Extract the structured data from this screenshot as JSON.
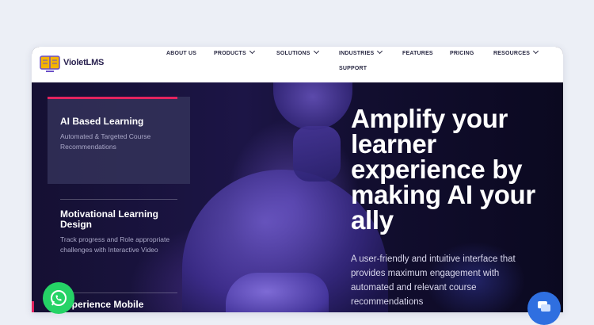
{
  "brand": {
    "name": "VioletLMS",
    "logo_icon": "book-icon"
  },
  "nav": {
    "items": [
      {
        "label": "ABOUT US",
        "dropdown": false
      },
      {
        "label": "PRODUCTS",
        "dropdown": true
      },
      {
        "label": "SOLUTIONS",
        "dropdown": true
      },
      {
        "label": "INDUSTRIES",
        "dropdown": true
      },
      {
        "label": "FEATURES",
        "dropdown": false
      },
      {
        "label": "PRICING",
        "dropdown": false
      },
      {
        "label": "RESOURCES",
        "dropdown": true
      },
      {
        "label": "SUPPORT",
        "dropdown": false
      }
    ]
  },
  "features": [
    {
      "title": "AI Based Learning",
      "description": "Automated & Targeted Course Recommendations",
      "active": true
    },
    {
      "title": "Motivational Learning Design",
      "description": "Track progress and Role appropriate challenges with Interactive Video",
      "active": false
    },
    {
      "title": "Experience Mobile",
      "description": "",
      "active": false
    }
  ],
  "hero": {
    "headline": "Amplify your learner experience by making AI your ally",
    "subtext": "A user-friendly and intuitive interface that provides maximum engagement with automated and relevant course recommendations"
  },
  "widgets": {
    "whatsapp_icon": "whatsapp-icon",
    "chat_icon": "chat-icon"
  },
  "colors": {
    "accent": "#e3245f",
    "whatsapp": "#25d366",
    "chat": "#2f6fe0",
    "hero_bg": "#0d0a26"
  }
}
